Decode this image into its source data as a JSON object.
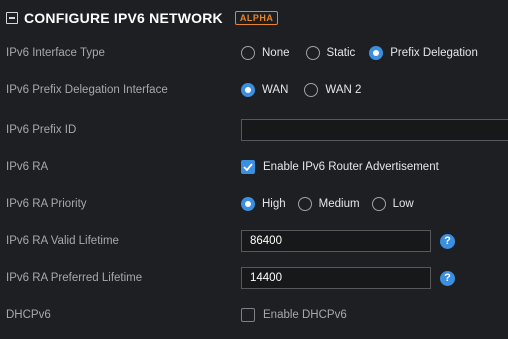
{
  "header": {
    "title": "CONFIGURE IPV6 NETWORK",
    "badge": "ALPHA"
  },
  "interface_type": {
    "label": "IPv6 Interface Type",
    "options": [
      "None",
      "Static",
      "Prefix Delegation"
    ],
    "selected": "Prefix Delegation"
  },
  "pd_interface": {
    "label": "IPv6 Prefix Delegation Interface",
    "options": [
      "WAN",
      "WAN 2"
    ],
    "selected": "WAN"
  },
  "prefix_id": {
    "label": "IPv6 Prefix ID",
    "value": ""
  },
  "ra": {
    "label": "IPv6 RA",
    "checkbox_label": "Enable IPv6 Router Advertisement",
    "checked": true
  },
  "ra_priority": {
    "label": "IPv6 RA Priority",
    "options": [
      "High",
      "Medium",
      "Low"
    ],
    "selected": "High"
  },
  "ra_valid_lifetime": {
    "label": "IPv6 RA Valid Lifetime",
    "value": "86400"
  },
  "ra_preferred_lifetime": {
    "label": "IPv6 RA Preferred Lifetime",
    "value": "14400"
  },
  "dhcpv6": {
    "label": "DHCPv6",
    "checkbox_label": "Enable DHCPv6",
    "checked": false
  },
  "icons": {
    "help": "?"
  },
  "colors": {
    "accent": "#3b8fe0",
    "badge": "#e8842b",
    "background": "#1e1f22"
  }
}
